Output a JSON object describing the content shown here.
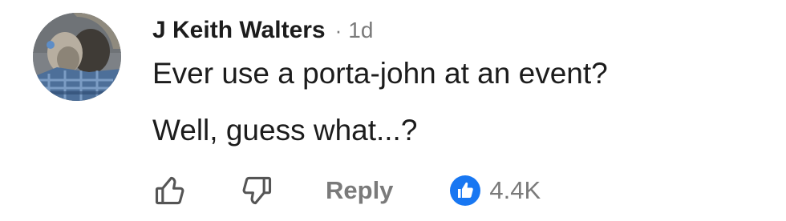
{
  "comment": {
    "author": "J Keith Walters",
    "separator": "·",
    "time": "1d",
    "text_lines": [
      "Ever use a porta-john at an event?",
      "Well, guess what...?"
    ],
    "actions": {
      "like_icon": "thumbs-up-outline-icon",
      "dislike_icon": "thumbs-down-outline-icon",
      "reply_label": "Reply",
      "reaction_icon": "like-reaction-icon",
      "reaction_count": "4.4K"
    }
  },
  "colors": {
    "text": "#1c1c1c",
    "secondary_text": "#7a7a7a",
    "reaction_blue": "#1877f2"
  }
}
